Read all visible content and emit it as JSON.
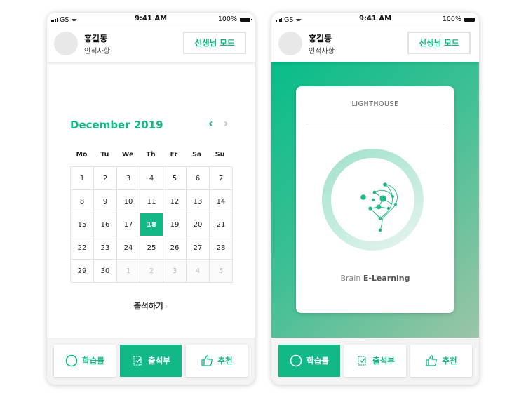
{
  "status_bar": {
    "carrier": "GS",
    "time": "9:41 AM",
    "battery": "100%"
  },
  "header": {
    "user_name": "홍길동",
    "user_sub": "인적사항",
    "mode_button": "선생님 모드"
  },
  "calendar": {
    "month_label": "December 2019",
    "weekdays": [
      "Mo",
      "Tu",
      "We",
      "Th",
      "Fr",
      "Sa",
      "Su"
    ],
    "days": [
      "1",
      "2",
      "3",
      "4",
      "5",
      "6",
      "7",
      "8",
      "9",
      "10",
      "11",
      "12",
      "13",
      "14",
      "15",
      "16",
      "17",
      "18",
      "19",
      "20",
      "21",
      "22",
      "23",
      "24",
      "25",
      "26",
      "27",
      "28",
      "29",
      "30",
      "1",
      "2",
      "3",
      "4",
      "5"
    ],
    "selected_day": "18",
    "attend_link": "출석하기"
  },
  "card": {
    "brand": "LIGHTHOUSE",
    "caption_prefix": "Brain",
    "caption_bold": "E-Learning"
  },
  "tabs": {
    "progress": "학습률",
    "attendance": "출석부",
    "recommend": "추천"
  },
  "colors": {
    "accent": "#12b886",
    "gradient_start": "#07bd88",
    "gradient_end": "#9cc5a6"
  },
  "icons": {
    "progress": "circle-icon",
    "attendance": "notebook-icon",
    "recommend": "thumbs-up-icon"
  }
}
